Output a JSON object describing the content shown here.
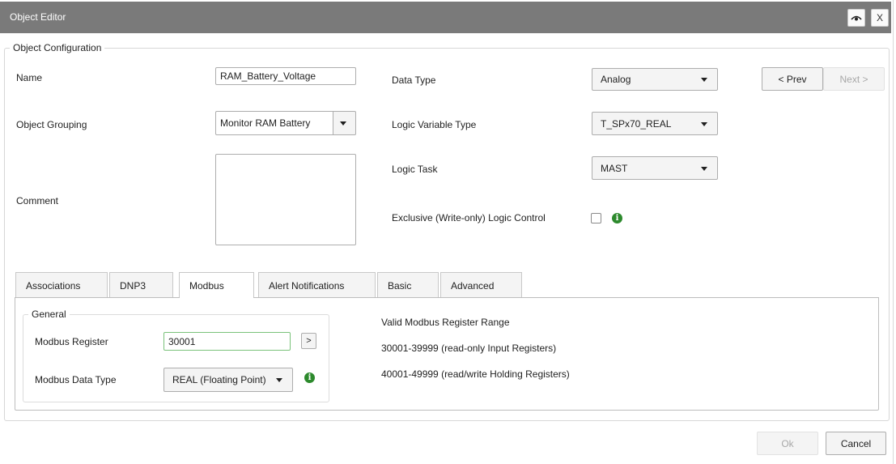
{
  "window": {
    "title": "Object Editor",
    "visibility_icon": "eye-icon",
    "close_label": "X"
  },
  "config": {
    "legend": "Object Configuration",
    "name_label": "Name",
    "name_value": "RAM_Battery_Voltage",
    "grouping_label": "Object Grouping",
    "grouping_value": "Monitor RAM Battery",
    "comment_label": "Comment",
    "comment_value": "",
    "data_type_label": "Data Type",
    "data_type_value": "Analog",
    "logic_var_label": "Logic Variable Type",
    "logic_var_value": "T_SPx70_REAL",
    "logic_task_label": "Logic Task",
    "logic_task_value": "MAST",
    "exclusive_label": "Exclusive (Write-only) Logic Control",
    "exclusive_checked": false,
    "prev_label": "< Prev",
    "next_label": "Next >"
  },
  "tabs": [
    {
      "label": "Associations",
      "active": false
    },
    {
      "label": "DNP3",
      "active": false
    },
    {
      "label": "Modbus",
      "active": true
    },
    {
      "label": "Alert Notifications",
      "active": false
    },
    {
      "label": "Basic",
      "active": false
    },
    {
      "label": "Advanced",
      "active": false
    }
  ],
  "modbus": {
    "general_legend": "General",
    "register_label": "Modbus Register",
    "register_value": "30001",
    "register_button": ">",
    "data_type_label": "Modbus Data Type",
    "data_type_value": "REAL (Floating Point)",
    "range_title": "Valid Modbus Register Range",
    "range_input": "30001-39999 (read-only Input Registers)",
    "range_holding": "40001-49999 (read/write Holding Registers)"
  },
  "footer": {
    "ok_label": "Ok",
    "cancel_label": "Cancel"
  },
  "colors": {
    "titlebar": "#7a7a7a",
    "info_icon": "#2d8a2d",
    "focus_border": "#7ac27a"
  }
}
